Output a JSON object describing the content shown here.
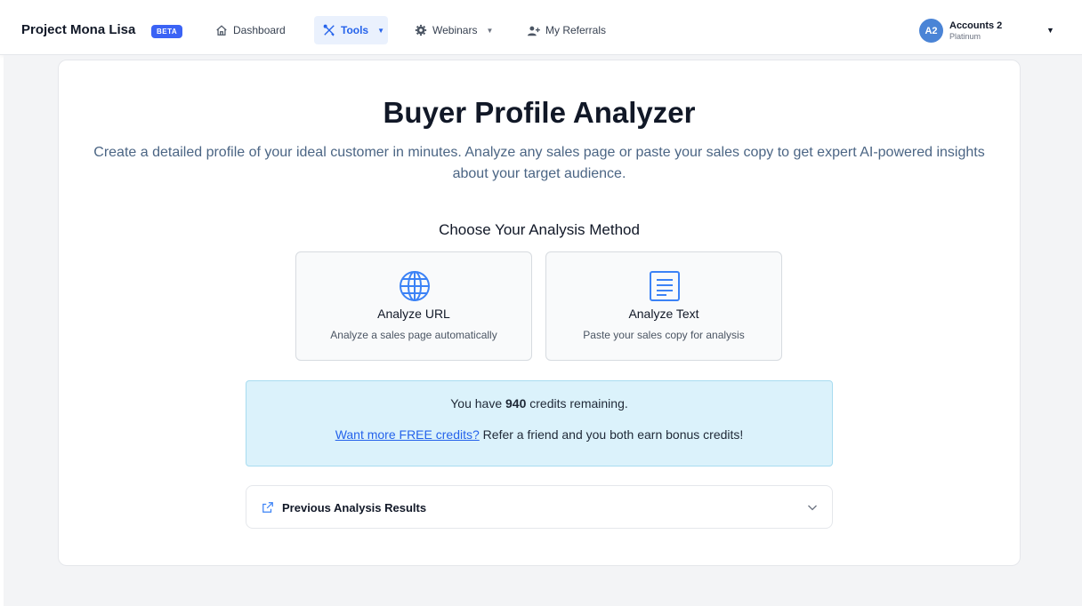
{
  "navbar": {
    "brand": "Project Mona Lisa",
    "badge": "BETA",
    "items": [
      {
        "label": "Dashboard",
        "icon": "home-icon",
        "active": false
      },
      {
        "label": "Tools",
        "icon": "tools-icon",
        "active": true
      },
      {
        "label": "Webinars",
        "icon": "gear-icon",
        "active": false
      },
      {
        "label": "My Referrals",
        "icon": "user-plus-icon",
        "active": false
      }
    ],
    "account": {
      "initials": "A2",
      "name": "Accounts 2",
      "plan": "Platinum"
    }
  },
  "main": {
    "title": "Buyer Profile Analyzer",
    "subtitle": "Create a detailed profile of your ideal customer in minutes. Analyze any sales page or paste your sales copy to get expert AI-powered insights about your target audience.",
    "choose_heading": "Choose Your Analysis Method",
    "methods": [
      {
        "title": "Analyze URL",
        "description": "Analyze a sales page automatically",
        "icon": "globe-icon"
      },
      {
        "title": "Analyze Text",
        "description": "Paste your sales copy for analysis",
        "icon": "document-icon"
      }
    ],
    "credits": {
      "prefix": "You have",
      "count": "940",
      "suffix": "credits remaining.",
      "link_text": "Want more FREE credits?",
      "referral_text": "Refer a friend and you both earn bonus credits!"
    },
    "previous_results": {
      "title": "Previous Analysis Results",
      "icon": "external-link-icon"
    }
  },
  "colors": {
    "accent": "#2563eb",
    "badge": "#3b63f5",
    "avatar": "#4a84d6",
    "credits_bg": "#dbf2fb",
    "page_bg": "#f3f4f6"
  }
}
